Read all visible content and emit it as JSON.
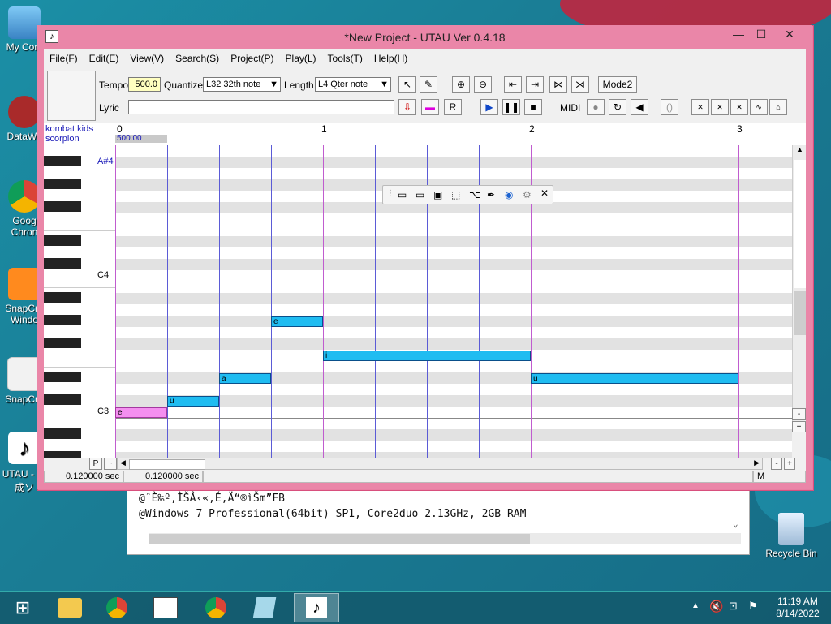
{
  "desktop": {
    "icons": [
      {
        "label": "My Com"
      },
      {
        "label": "DataWa"
      },
      {
        "label": "Goog Chron"
      },
      {
        "label": "SnapCra Windo"
      },
      {
        "label": "SnapCra"
      },
      {
        "label": "UTAU - 合成ソ"
      },
      {
        "label": "Recycle Bin"
      }
    ]
  },
  "window": {
    "title": "*New Project - UTAU Ver 0.4.18",
    "minimize": "—",
    "maximize": "☐",
    "close": "✕"
  },
  "menu": [
    "File(F)",
    "Edit(E)",
    "View(V)",
    "Search(S)",
    "Project(P)",
    "Play(L)",
    "Tools(T)",
    "Help(H)"
  ],
  "toolbar": {
    "tempo_label": "Tempo",
    "tempo_value": "500.0",
    "quantize_label": "Quantize",
    "quantize_value": "L32 32th note",
    "length_label": "Length",
    "length_value": "L4  Qter note",
    "mode_button": "Mode2",
    "lyric_label": "Lyric",
    "lyric_value": "",
    "midi_label": "MIDI"
  },
  "track": {
    "name_line1": "kombat kids",
    "name_line2": "scorpion",
    "tempo_marker": "500.00",
    "measures": [
      "0",
      "1",
      "2",
      "3"
    ]
  },
  "piano": {
    "labels": [
      {
        "text": "A#4"
      },
      {
        "text": "C4"
      },
      {
        "text": "C3"
      }
    ]
  },
  "notes": [
    {
      "lyric": "e",
      "color": "#f48ff0"
    },
    {
      "lyric": "u",
      "color": "#1fbcf1"
    },
    {
      "lyric": "a",
      "color": "#1fbcf1"
    },
    {
      "lyric": "e",
      "color": "#1fbcf1"
    },
    {
      "lyric": "i",
      "color": "#1fbcf1"
    },
    {
      "lyric": "u",
      "color": "#1fbcf1"
    }
  ],
  "bottom": {
    "p_button": "P",
    "tilde_button": "~",
    "time1": "0.120000 sec",
    "time2": "0.120000 sec",
    "m_label": "M",
    "minus": "-",
    "plus": "+"
  },
  "bgwindow": {
    "line1": "@ˆÈ‰º,ÌŠÂ‹«,É,Ä“®ìŠm”FB",
    "line2": "@Windows 7 Professional(64bit) SP1, Core2duo 2.13GHz, 2GB RAM"
  },
  "taskbar": {
    "time": "11:19 AM",
    "date": "8/14/2022"
  },
  "colors": {
    "frame": "#ea86a8",
    "note_blue": "#1fbcf1",
    "note_pink": "#f48ff0",
    "measure_line": "#c05ccf",
    "beat_line": "#5b5bd6"
  }
}
